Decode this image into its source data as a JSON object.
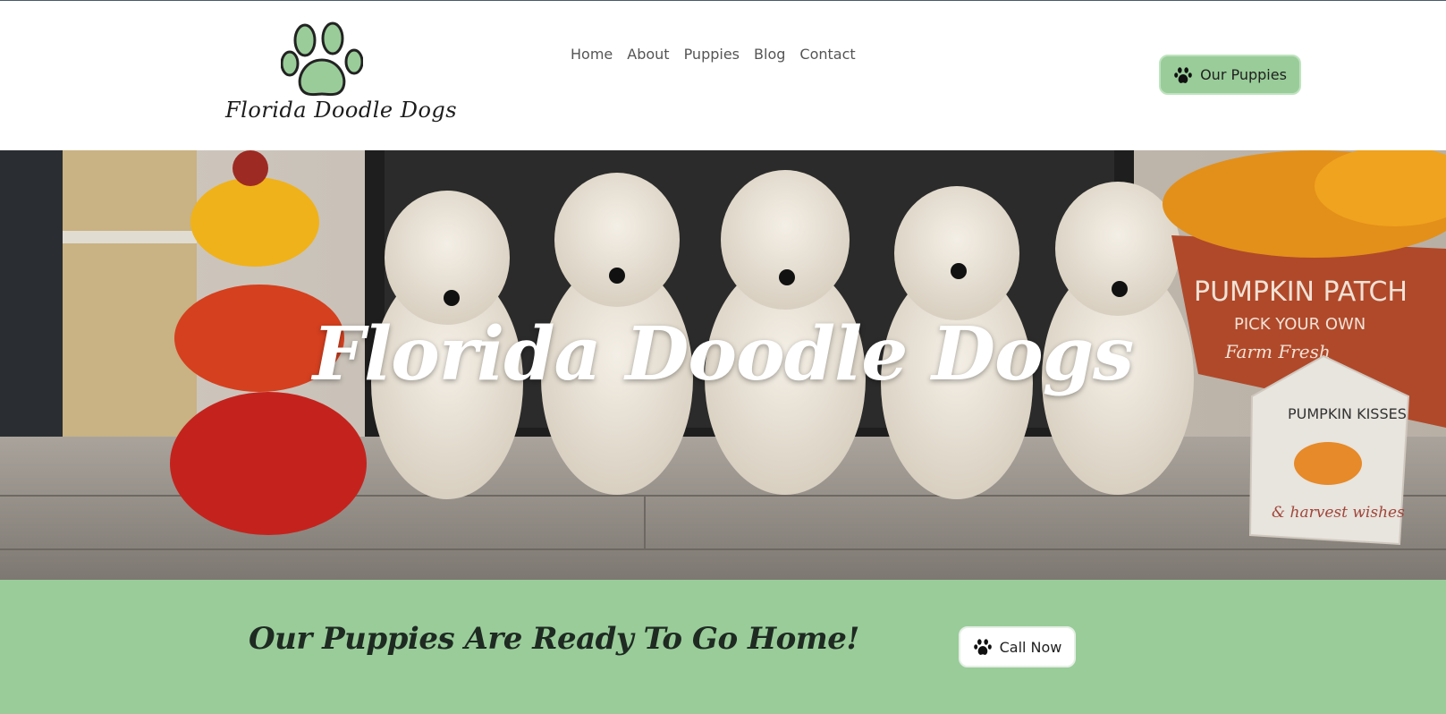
{
  "header": {
    "logo_text": "Florida Doodle Dogs",
    "logo_icon": "paw-print-icon",
    "nav": [
      {
        "label": "Home"
      },
      {
        "label": "About"
      },
      {
        "label": "Puppies"
      },
      {
        "label": "Blog"
      },
      {
        "label": "Contact"
      }
    ],
    "cta_button": {
      "label": "Our Puppies",
      "icon": "paw-icon"
    }
  },
  "hero": {
    "title": "Florida Doodle Dogs",
    "image_sign_1": "PUMPKIN PATCH",
    "image_sign_2": "PICK YOUR OWN",
    "image_sign_3": "Farm Fresh",
    "image_tag_1": "PUMPKIN KISSES",
    "image_tag_2": "& harvest wishes"
  },
  "cta": {
    "heading": "Our Puppies Are Ready To Go Home!",
    "button": {
      "label": "Call Now",
      "icon": "paw-icon"
    }
  },
  "colors": {
    "brand_green": "#99cc99",
    "text_dark": "#1e2a22",
    "nav_text": "#555555"
  }
}
